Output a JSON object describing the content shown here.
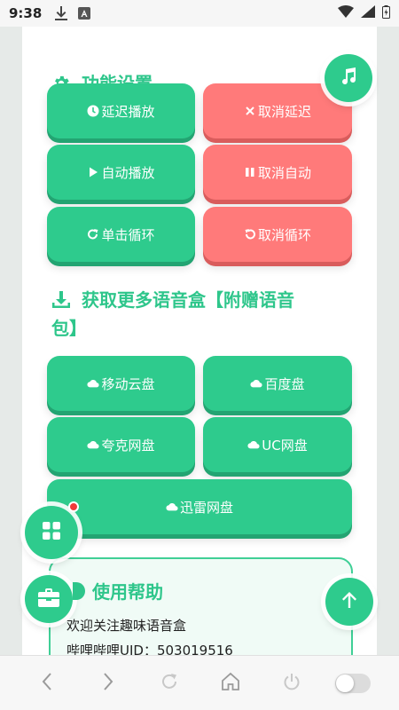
{
  "status_bar": {
    "time": "9:38"
  },
  "sections": {
    "settings_title": "功能设置",
    "download_title_line1": "获取更多语音盒【附赠语音",
    "download_title_line2": "包】",
    "help_title": "使用帮助"
  },
  "settings_buttons": [
    {
      "label": "延迟播放",
      "style": "green",
      "icon": "clock-icon"
    },
    {
      "label": "取消延迟",
      "style": "red",
      "icon": "x-icon"
    },
    {
      "label": "自动播放",
      "style": "green",
      "icon": "play-icon"
    },
    {
      "label": "取消自动",
      "style": "red",
      "icon": "pause-icon"
    },
    {
      "label": "单击循环",
      "style": "green",
      "icon": "redo-icon"
    },
    {
      "label": "取消循环",
      "style": "red",
      "icon": "undo-icon"
    }
  ],
  "download_buttons": [
    {
      "label": "移动云盘",
      "icon": "cloud-icon"
    },
    {
      "label": "百度盘",
      "icon": "cloud-icon"
    },
    {
      "label": "夸克网盘",
      "icon": "cloud-icon"
    },
    {
      "label": "UC网盘",
      "icon": "cloud-icon"
    },
    {
      "label": "迅雷网盘",
      "icon": "cloud-icon"
    }
  ],
  "help": {
    "line1": "欢迎关注趣味语音盒",
    "line2": "哔哩哔哩UID：503019516"
  },
  "colors": {
    "accent": "#2ecb8d",
    "danger": "#ff7a7a",
    "title": "#2ec68b",
    "badge": "#f03a3a"
  }
}
